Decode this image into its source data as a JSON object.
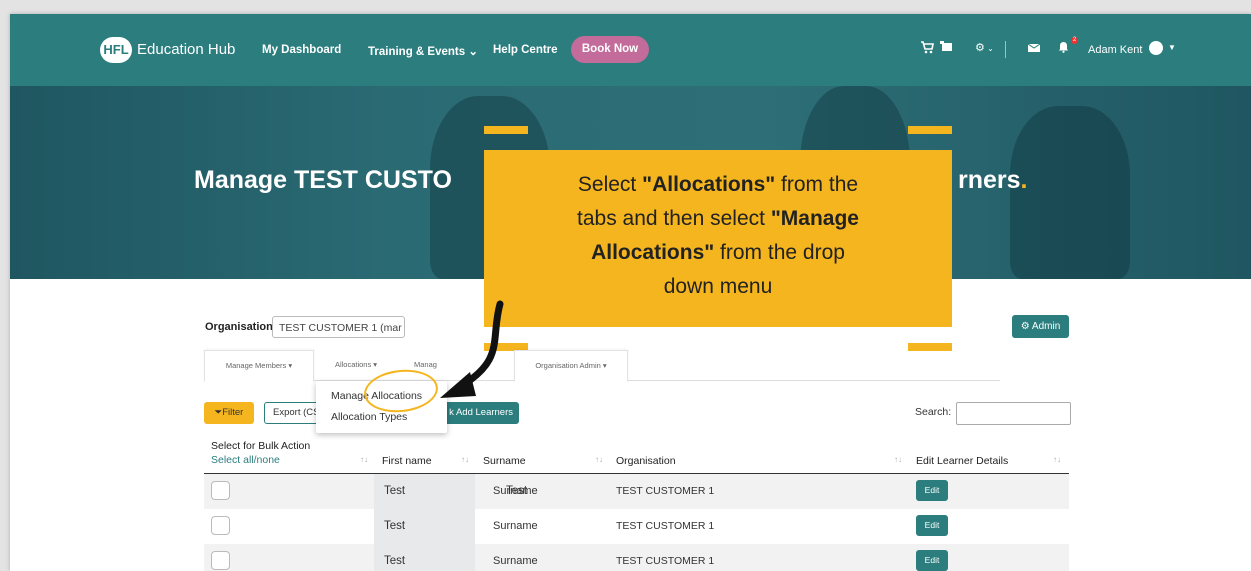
{
  "nav": {
    "logo_mark": "HFL",
    "logo_text": "Education Hub",
    "links": [
      "My Dashboard",
      "Training & Events",
      "Help Centre"
    ],
    "book_now": "Book Now",
    "notification_count": "2",
    "user_name": "Adam Kent",
    "icons": [
      "cart-icon",
      "basket-icon",
      "gear-icon",
      "mail-icon",
      "bell-icon",
      "avatar-icon"
    ]
  },
  "hero": {
    "title_left": "Manage TEST CUSTO",
    "title_right": "rners",
    "title_dot": "."
  },
  "callout": {
    "parts": [
      "Select ",
      "\"Allocations\"",
      " from the tabs and then select ",
      "\"Manage Allocations\"",
      " from the drop down menu"
    ]
  },
  "org": {
    "label": "Organisation",
    "value": "TEST CUSTOMER 1 (mar",
    "admin_button": "Admin"
  },
  "tabs": [
    "Manage Members ▾",
    "Allocations ▾",
    "Manag",
    "Organisation Admin ▾"
  ],
  "dropdown": [
    "Manage Allocations",
    "Allocation Types"
  ],
  "toolbar": {
    "filter": "Filter",
    "export": "Export (CS",
    "bulk_add": "k Add Learners",
    "search_label": "Search:"
  },
  "table": {
    "bulk_header": "Select for Bulk Action",
    "select_all": "Select all/none",
    "columns": [
      "First name",
      "Surname",
      "Organisation",
      "Edit Learner Details"
    ],
    "rows": [
      {
        "first": "Test",
        "surname": "Surname",
        "org": "TEST CUSTOMER 1",
        "action": "Edit"
      },
      {
        "first": "Test",
        "surname": "Surname",
        "org": "TEST CUSTOMER 1",
        "action": "Edit"
      },
      {
        "first": "Test",
        "surname": "Surname",
        "org": "TEST CUSTOMER 1",
        "action": "Edit"
      }
    ]
  },
  "colors": {
    "brand_teal": "#2b7d7e",
    "accent_yellow": "#f5b51e",
    "book_pink": "#c36b9a"
  }
}
